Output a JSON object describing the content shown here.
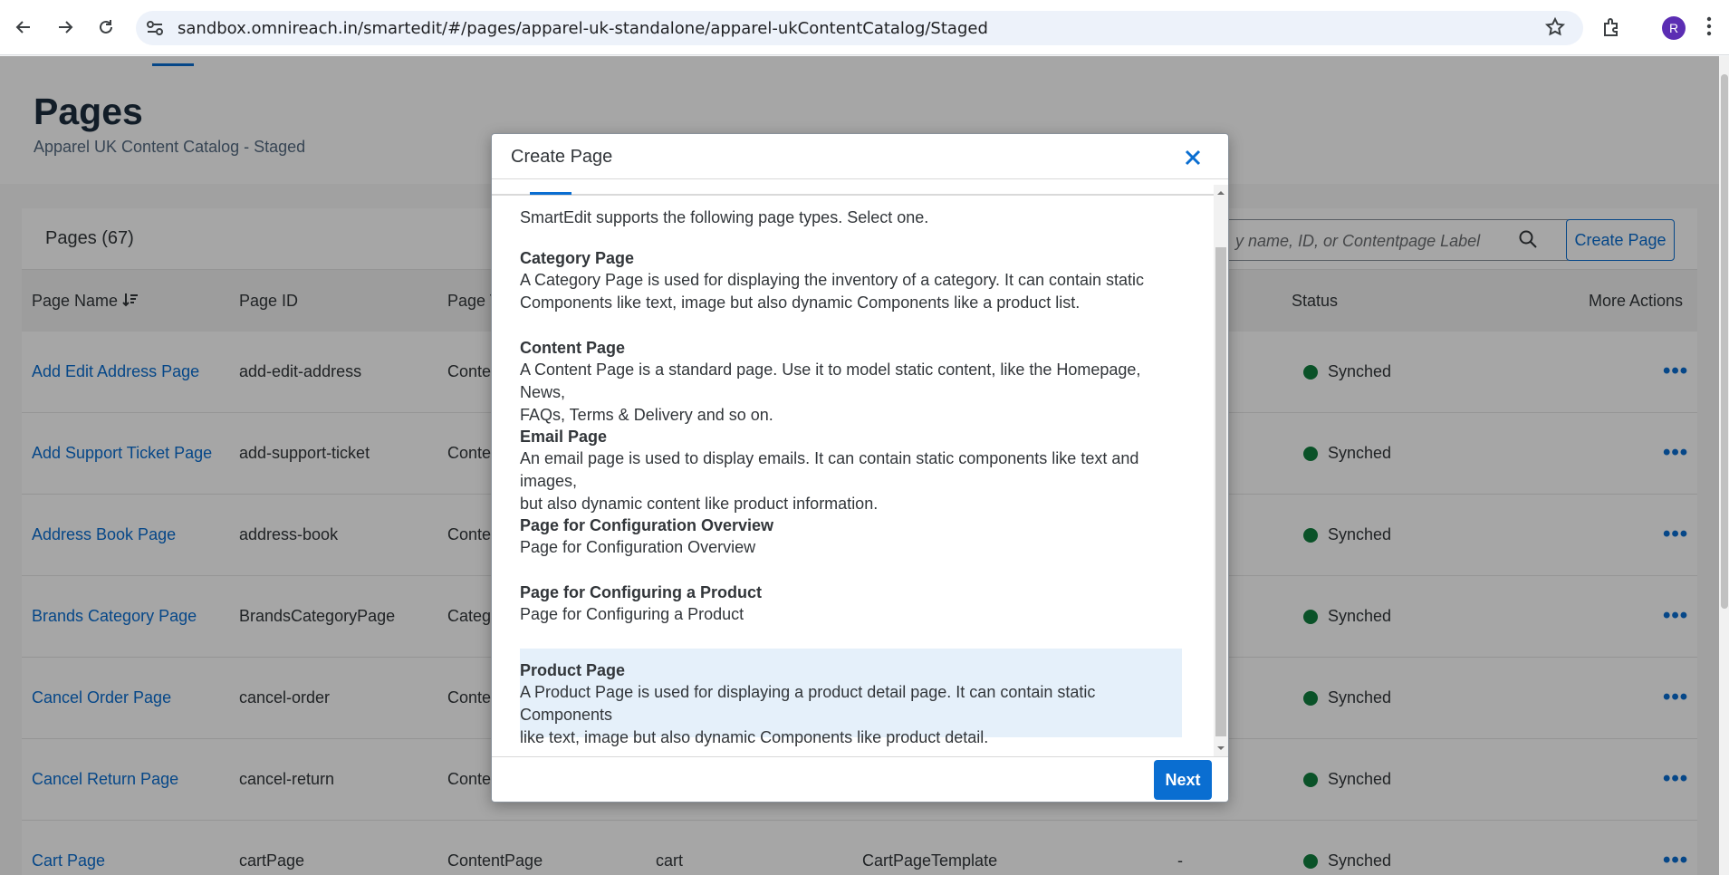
{
  "browser": {
    "url": "sandbox.omnireach.in/smartedit/#/pages/apparel-uk-standalone/apparel-ukContentCatalog/Staged",
    "avatar_letter": "R"
  },
  "header": {
    "title": "Pages",
    "subtitle": "Apparel UK Content Catalog - Staged"
  },
  "toolbar": {
    "pages_count": "Pages (67)",
    "search_placeholder": "y name, ID, or Contentpage Label",
    "create_label": "Create Page"
  },
  "table": {
    "columns": {
      "name": "Page Name",
      "id": "Page ID",
      "type": "Page T",
      "status": "Status",
      "actions": "More Actions"
    },
    "rows": [
      {
        "name": "Add Edit Address Page",
        "id": "add-edit-address",
        "type": "Conten",
        "status": "Synched"
      },
      {
        "name": "Add Support Ticket Page",
        "id": "add-support-ticket",
        "type": "Conten",
        "status": "Synched"
      },
      {
        "name": "Address Book Page",
        "id": "address-book",
        "type": "Conten",
        "status": "Synched"
      },
      {
        "name": "Brands Category Page",
        "id": "BrandsCategoryPage",
        "type": "Categ",
        "status": "Synched"
      },
      {
        "name": "Cancel Order Page",
        "id": "cancel-order",
        "type": "Conten",
        "status": "Synched"
      },
      {
        "name": "Cancel Return Page",
        "id": "cancel-return",
        "type": "Conten",
        "status": "Synched"
      },
      {
        "name": "Cart Page",
        "id": "cartPage",
        "type": "ContentPage",
        "label": "cart",
        "template": "CartPageTemplate",
        "dash": "-",
        "status": "Synched"
      }
    ]
  },
  "modal": {
    "title": "Create Page",
    "intro": "SmartEdit supports the following page types. Select one.",
    "types": [
      {
        "title": "Category Page",
        "desc1": "A Category Page is used for displaying the inventory of a category. It can contain static",
        "desc2": "Components like text, image but also dynamic Components like a product list."
      },
      {
        "title": "Content Page",
        "desc1": "A Content Page is a standard page. Use it to model static content, like the Homepage, News,",
        "desc2": "FAQs, Terms & Delivery and so on."
      },
      {
        "title": "Email Page",
        "desc1": "An email page is used to display emails. It can contain static components like text and images,",
        "desc2": "but also dynamic content like product information."
      },
      {
        "title": "Page for Configuration Overview",
        "desc1": "Page for Configuration Overview",
        "desc2": ""
      },
      {
        "title": "Page for Configuring a Product",
        "desc1": "Page for Configuring a Product",
        "desc2": ""
      },
      {
        "title": "Product Page",
        "desc1": "A Product Page is used for displaying a product detail page. It can contain static Components",
        "desc2": "like text, image but also dynamic Components like product detail."
      }
    ],
    "selected": "Product Page",
    "next_label": "Next"
  }
}
